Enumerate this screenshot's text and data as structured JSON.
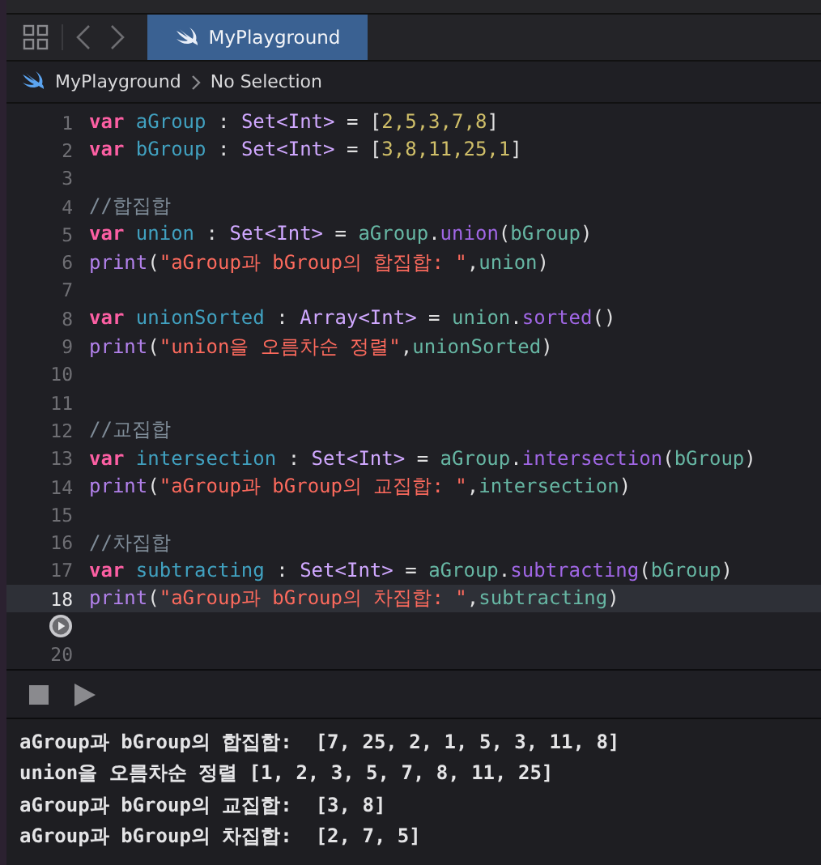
{
  "tab": {
    "title": "MyPlayground",
    "selected": true
  },
  "breadcrumb": [
    "MyPlayground",
    "No Selection"
  ],
  "editor": {
    "lines": [
      {
        "kind": "code",
        "number": "1",
        "current": false,
        "tokens": [
          {
            "kind": "keyword",
            "text": "var "
          },
          {
            "kind": "decl",
            "text": "aGroup"
          },
          {
            "kind": "plain",
            "text": " : "
          },
          {
            "kind": "type",
            "text": "Set<Int>"
          },
          {
            "kind": "plain",
            "text": " = ["
          },
          {
            "kind": "number",
            "text": "2,5,3,7,8"
          },
          {
            "kind": "plain",
            "text": "]"
          }
        ]
      },
      {
        "kind": "code",
        "number": "2",
        "current": false,
        "tokens": [
          {
            "kind": "keyword",
            "text": "var "
          },
          {
            "kind": "decl",
            "text": "bGroup"
          },
          {
            "kind": "plain",
            "text": " : "
          },
          {
            "kind": "type",
            "text": "Set<Int>"
          },
          {
            "kind": "plain",
            "text": " = ["
          },
          {
            "kind": "number",
            "text": "3,8,11,25,1"
          },
          {
            "kind": "plain",
            "text": "]"
          }
        ]
      },
      {
        "kind": "code",
        "number": "3",
        "current": false
      },
      {
        "kind": "code",
        "number": "4",
        "current": false,
        "tokens": [
          {
            "kind": "comment",
            "text": "//합집합"
          }
        ]
      },
      {
        "kind": "code",
        "number": "5",
        "current": false,
        "tokens": [
          {
            "kind": "keyword",
            "text": "var "
          },
          {
            "kind": "decl",
            "text": "union"
          },
          {
            "kind": "plain",
            "text": " : "
          },
          {
            "kind": "type",
            "text": "Set<Int>"
          },
          {
            "kind": "plain",
            "text": " = "
          },
          {
            "kind": "ref",
            "text": "aGroup"
          },
          {
            "kind": "plain",
            "text": "."
          },
          {
            "kind": "method",
            "text": "union"
          },
          {
            "kind": "plain",
            "text": "("
          },
          {
            "kind": "ref",
            "text": "bGroup"
          },
          {
            "kind": "plain",
            "text": ")"
          }
        ]
      },
      {
        "kind": "code",
        "number": "6",
        "current": false,
        "tokens": [
          {
            "kind": "func",
            "text": "print"
          },
          {
            "kind": "plain",
            "text": "("
          },
          {
            "kind": "string",
            "text": "\"aGroup과 bGroup의 합집합: \""
          },
          {
            "kind": "plain",
            "text": ","
          },
          {
            "kind": "ref",
            "text": "union"
          },
          {
            "kind": "plain",
            "text": ")"
          }
        ]
      },
      {
        "kind": "code",
        "number": "7",
        "current": false
      },
      {
        "kind": "code",
        "number": "8",
        "current": false,
        "tokens": [
          {
            "kind": "keyword",
            "text": "var "
          },
          {
            "kind": "decl",
            "text": "unionSorted"
          },
          {
            "kind": "plain",
            "text": " : "
          },
          {
            "kind": "type",
            "text": "Array<Int>"
          },
          {
            "kind": "plain",
            "text": " = "
          },
          {
            "kind": "ref",
            "text": "union"
          },
          {
            "kind": "plain",
            "text": "."
          },
          {
            "kind": "method",
            "text": "sorted"
          },
          {
            "kind": "plain",
            "text": "()"
          }
        ]
      },
      {
        "kind": "code",
        "number": "9",
        "current": false,
        "tokens": [
          {
            "kind": "func",
            "text": "print"
          },
          {
            "kind": "plain",
            "text": "("
          },
          {
            "kind": "string",
            "text": "\"union을 오름차순 정렬\""
          },
          {
            "kind": "plain",
            "text": ","
          },
          {
            "kind": "ref",
            "text": "unionSorted"
          },
          {
            "kind": "plain",
            "text": ")"
          }
        ]
      },
      {
        "kind": "code",
        "number": "10",
        "current": false
      },
      {
        "kind": "code",
        "number": "11",
        "current": false
      },
      {
        "kind": "code",
        "number": "12",
        "current": false,
        "tokens": [
          {
            "kind": "comment",
            "text": "//교집합"
          }
        ]
      },
      {
        "kind": "code",
        "number": "13",
        "current": false,
        "tokens": [
          {
            "kind": "keyword",
            "text": "var "
          },
          {
            "kind": "decl",
            "text": "intersection"
          },
          {
            "kind": "plain",
            "text": " : "
          },
          {
            "kind": "type",
            "text": "Set<Int>"
          },
          {
            "kind": "plain",
            "text": " = "
          },
          {
            "kind": "ref",
            "text": "aGroup"
          },
          {
            "kind": "plain",
            "text": "."
          },
          {
            "kind": "method",
            "text": "intersection"
          },
          {
            "kind": "plain",
            "text": "("
          },
          {
            "kind": "ref",
            "text": "bGroup"
          },
          {
            "kind": "plain",
            "text": ")"
          }
        ]
      },
      {
        "kind": "code",
        "number": "14",
        "current": false,
        "tokens": [
          {
            "kind": "func",
            "text": "print"
          },
          {
            "kind": "plain",
            "text": "("
          },
          {
            "kind": "string",
            "text": "\"aGroup과 bGroup의 교집합: \""
          },
          {
            "kind": "plain",
            "text": ","
          },
          {
            "kind": "ref",
            "text": "intersection"
          },
          {
            "kind": "plain",
            "text": ")"
          }
        ]
      },
      {
        "kind": "code",
        "number": "15",
        "current": false
      },
      {
        "kind": "code",
        "number": "16",
        "current": false,
        "tokens": [
          {
            "kind": "comment",
            "text": "//차집합"
          }
        ]
      },
      {
        "kind": "code",
        "number": "17",
        "current": false,
        "tokens": [
          {
            "kind": "keyword",
            "text": "var "
          },
          {
            "kind": "decl",
            "text": "subtracting"
          },
          {
            "kind": "plain",
            "text": " : "
          },
          {
            "kind": "type",
            "text": "Set<Int>"
          },
          {
            "kind": "plain",
            "text": " = "
          },
          {
            "kind": "ref",
            "text": "aGroup"
          },
          {
            "kind": "plain",
            "text": "."
          },
          {
            "kind": "method",
            "text": "subtracting"
          },
          {
            "kind": "plain",
            "text": "("
          },
          {
            "kind": "ref",
            "text": "bGroup"
          },
          {
            "kind": "plain",
            "text": ")"
          }
        ]
      },
      {
        "kind": "code",
        "number": "18",
        "current": true,
        "tokens": [
          {
            "kind": "func",
            "text": "print"
          },
          {
            "kind": "plain",
            "text": "("
          },
          {
            "kind": "string",
            "text": "\"aGroup과 bGroup의 차집합: \""
          },
          {
            "kind": "plain",
            "text": ","
          },
          {
            "kind": "ref",
            "text": "subtracting"
          },
          {
            "kind": "plain",
            "text": ")"
          }
        ]
      },
      {
        "kind": "run",
        "current": false
      },
      {
        "kind": "code",
        "number": "20",
        "current": false
      }
    ]
  },
  "console": {
    "lines": [
      "aGroup과 bGroup의 합집합:  [7, 25, 2, 1, 5, 3, 11, 8]",
      "union을 오름차순 정렬 [1, 2, 3, 5, 7, 8, 11, 25]",
      "aGroup과 bGroup의 교집합:  [3, 8]",
      "aGroup과 bGroup의 차집합:  [2, 7, 5]"
    ]
  }
}
